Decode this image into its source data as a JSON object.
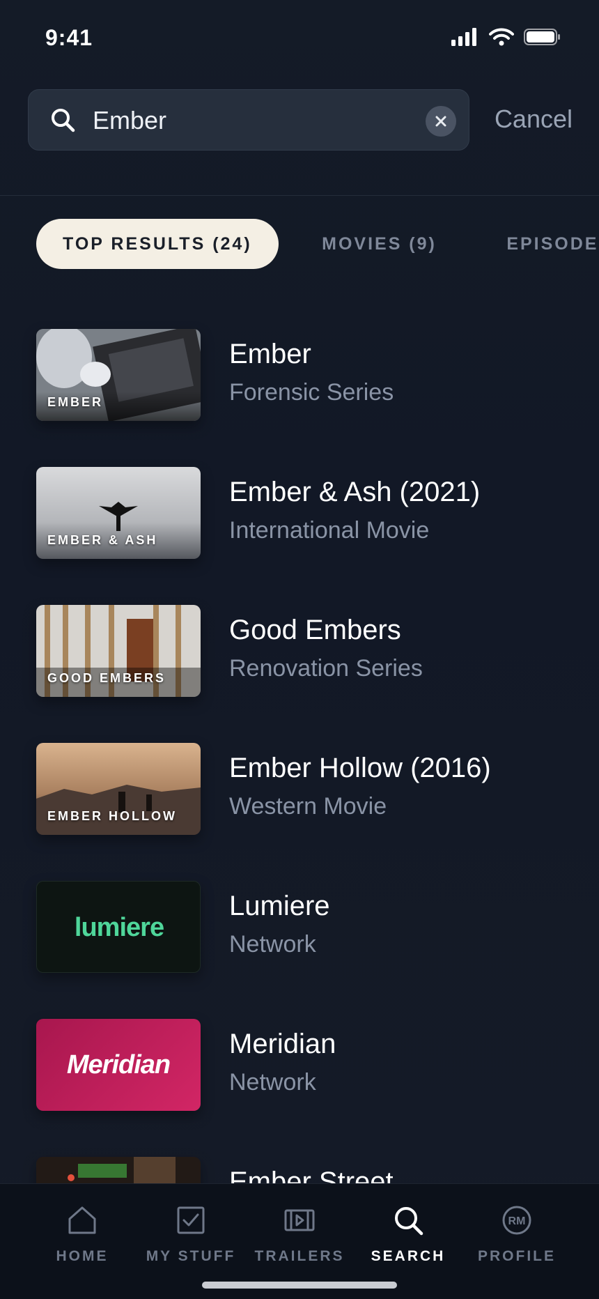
{
  "status_bar": {
    "time": "9:41"
  },
  "search": {
    "value": "Ember",
    "cancel_label": "Cancel"
  },
  "tabs": [
    {
      "label": "TOP RESULTS (24)",
      "active": true
    },
    {
      "label": "MOVIES (9)",
      "active": false
    },
    {
      "label": "EPISODES",
      "active": false
    }
  ],
  "results": [
    {
      "title": "Ember",
      "subtitle": "Forensic Series",
      "thumb_label": "EMBER"
    },
    {
      "title": "Ember & Ash (2021)",
      "subtitle": "International Movie",
      "thumb_label": "EMBER & ASH"
    },
    {
      "title": "Good Embers",
      "subtitle": "Renovation Series",
      "thumb_label": "GOOD EMBERS"
    },
    {
      "title": "Ember Hollow (2016)",
      "subtitle": "Western Movie",
      "thumb_label": "EMBER HOLLOW"
    },
    {
      "title": "Lumiere",
      "subtitle": "Network",
      "thumb_label": "lumiere"
    },
    {
      "title": "Meridian",
      "subtitle": "Network",
      "thumb_label": "Meridian"
    },
    {
      "title": "Ember Street",
      "subtitle": "",
      "thumb_label": ""
    }
  ],
  "nav": [
    {
      "label": "HOME",
      "icon": "home-icon"
    },
    {
      "label": "MY STUFF",
      "icon": "checkbox-icon"
    },
    {
      "label": "TRAILERS",
      "icon": "play-frame-icon"
    },
    {
      "label": "SEARCH",
      "icon": "search-icon",
      "active": true
    },
    {
      "label": "PROFILE",
      "icon": "avatar-icon",
      "initials": "RM"
    }
  ],
  "colors": {
    "accent_pill": "#f4efe4",
    "lumiere_green": "#4fd69a",
    "meridian_pink": "#c8205f"
  }
}
